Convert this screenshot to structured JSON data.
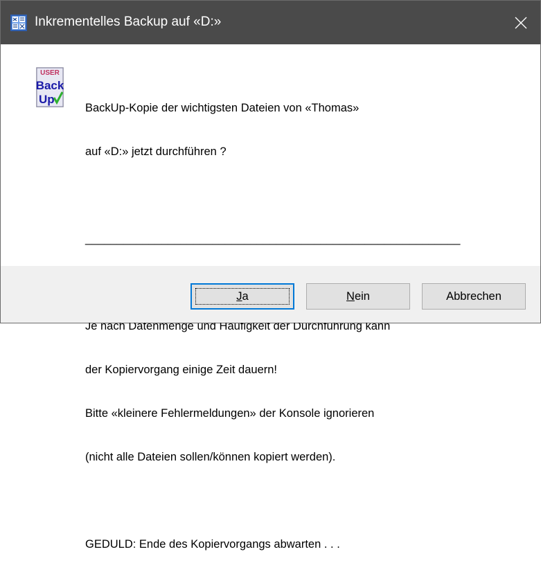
{
  "window": {
    "title": "Inkrementelles Backup auf «D:»",
    "close_glyph": "✕",
    "app_icon": "window-grid-icon"
  },
  "message_icon": {
    "name": "user-backup-icon",
    "line1": "USER",
    "line2": "Back",
    "line3": "Up"
  },
  "message": {
    "lines": [
      "BackUp-Kopie der wichtigsten Dateien von «Thomas»",
      "auf «D:» jetzt durchführen ?",
      "",
      "___________________________________________________________",
      "",
      "Je nach Datenmenge und Häufigkeit der Durchführung kann",
      "der Kopiervorgang einige Zeit dauern!",
      "Bitte «kleinere Fehlermeldungen» der Konsole ignorieren",
      "(nicht alle Dateien sollen/können kopiert werden).",
      "",
      "GEDULD: Ende des Kopiervorgangs abwarten . . ."
    ]
  },
  "buttons": {
    "yes": {
      "accel": "J",
      "rest": "a"
    },
    "no": {
      "accel": "N",
      "rest": "ein"
    },
    "cancel": {
      "label": "Abbrechen"
    }
  },
  "colors": {
    "titlebar": "#4a4a4a",
    "footer": "#f0f0f0",
    "focus_border": "#0078d7",
    "checkmark": "#2fb12f",
    "icon_blue": "#1a1aa8"
  }
}
